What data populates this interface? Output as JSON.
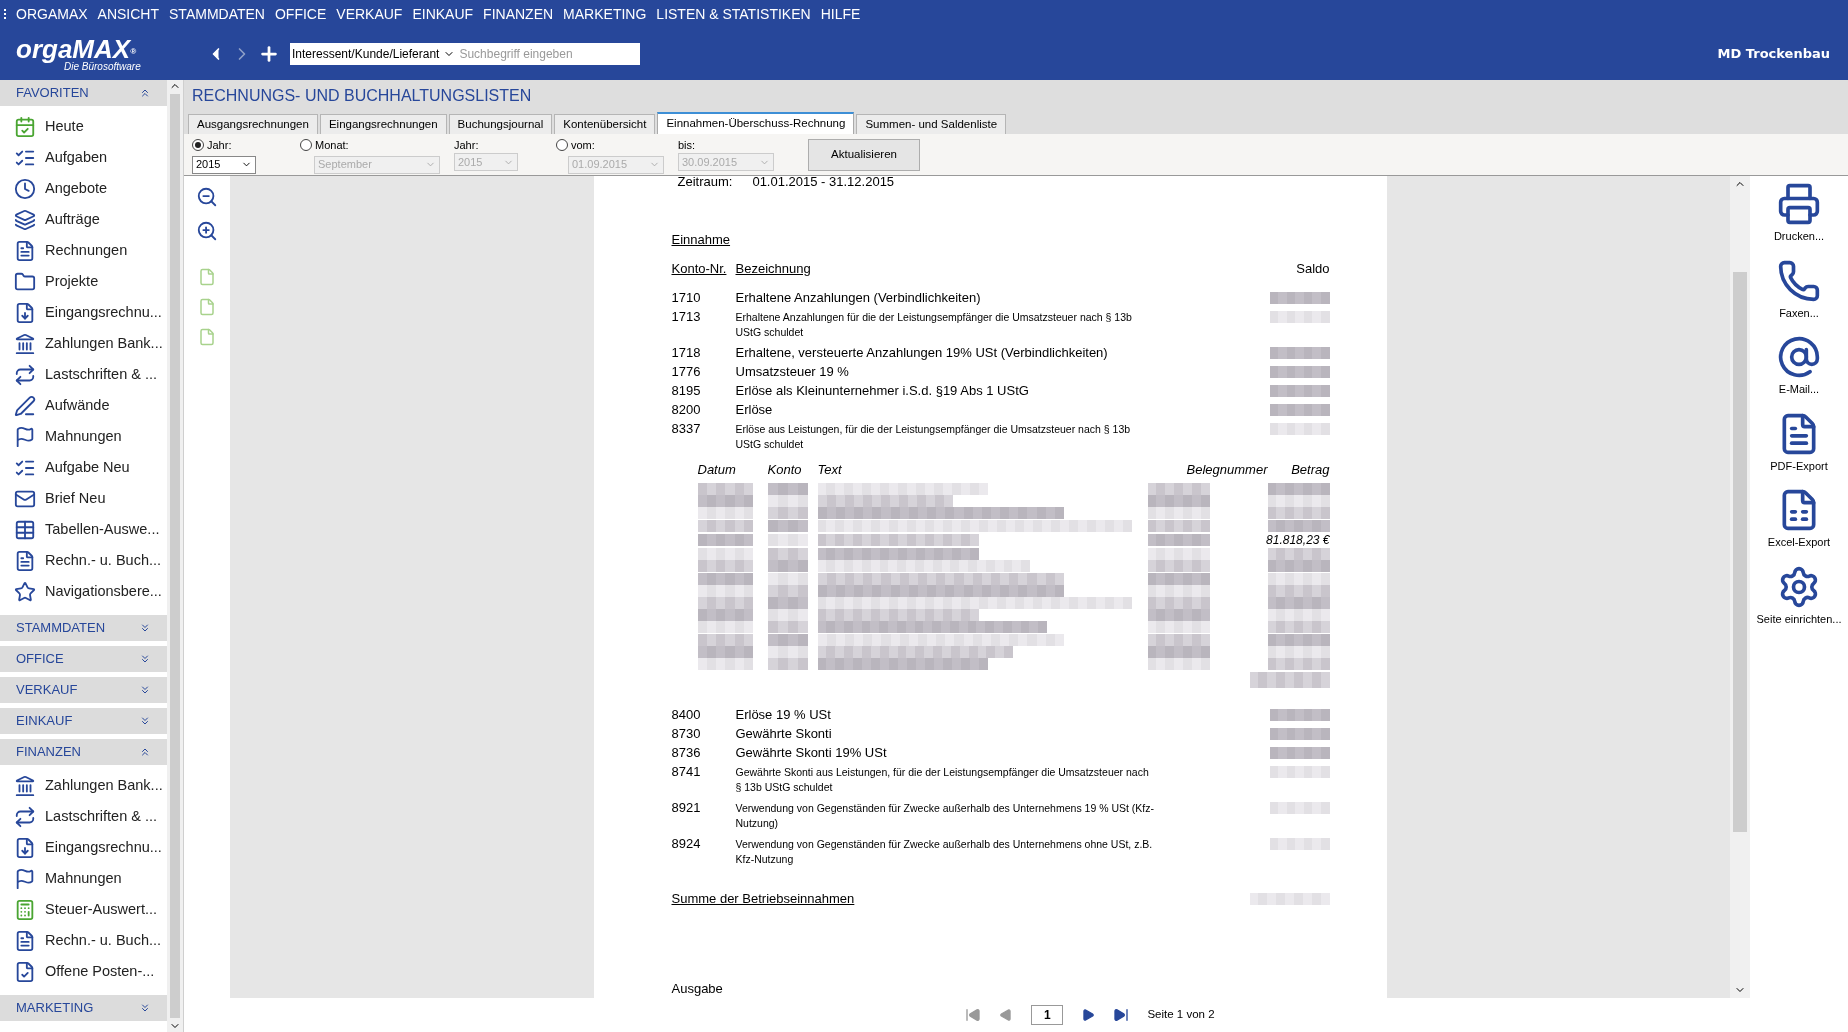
{
  "menu_bar": [
    "ORGAMAX",
    "ANSICHT",
    "STAMMDATEN",
    "OFFICE",
    "VERKAUF",
    "EINKAUF",
    "FINANZEN",
    "MARKETING",
    "LISTEN & STATISTIKEN",
    "HILFE"
  ],
  "header": {
    "logo": "orgaMAX",
    "logo_mark": "®",
    "logo_tagline": "Die Bürosoftware",
    "search_category": "Interessent/Kunde/Lieferant",
    "search": {
      "placeholder": "Suchbegriff eingeben"
    },
    "company": "MD Trockenbau"
  },
  "sidebar": [
    {
      "label": "FAVORITEN",
      "expanded": true,
      "items": [
        "Heute",
        "Aufgaben",
        "Angebote",
        "Aufträge",
        "Rechnungen",
        "Projekte",
        "Eingangsrechnu...",
        "Zahlungen Bank...",
        "Lastschriften & ...",
        "Aufwände",
        "Mahnungen",
        "Aufgabe Neu",
        "Brief Neu",
        "Tabellen-Auswe...",
        "Rechn.- u. Buch...",
        "Navigationsbere..."
      ]
    },
    {
      "label": "STAMMDATEN",
      "expanded": false
    },
    {
      "label": "OFFICE",
      "expanded": false
    },
    {
      "label": "VERKAUF",
      "expanded": false
    },
    {
      "label": "EINKAUF",
      "expanded": false
    },
    {
      "label": "FINANZEN",
      "expanded": true,
      "items": [
        "Zahlungen Bank...",
        "Lastschriften & ...",
        "Eingangsrechnu...",
        "Mahnungen",
        "Steuer-Auswert...",
        "Rechn.- u. Buch...",
        "Offene Posten-..."
      ]
    },
    {
      "label": "MARKETING",
      "expanded": false
    }
  ],
  "page_title": "RECHNUNGS- UND BUCHHALTUNGSLISTEN",
  "tabs": [
    {
      "label": "Ausgangsrechnungen",
      "selected": false
    },
    {
      "label": "Eingangsrechnungen",
      "selected": false
    },
    {
      "label": "Buchungsjournal",
      "selected": false
    },
    {
      "label": "Kontenübersicht",
      "selected": false
    },
    {
      "label": "Einnahmen-Überschuss-Rechnung",
      "selected": true
    },
    {
      "label": "Summen- und Saldenliste",
      "selected": false
    }
  ],
  "filters": {
    "year": {
      "label": "Jahr:",
      "selected": true,
      "value": "2015",
      "disabled": false
    },
    "month": {
      "label": "Monat:",
      "selected": false,
      "value": "September",
      "disabled": true,
      "year_label": "Jahr:",
      "year_value": "2015"
    },
    "range": {
      "label": "vom:",
      "selected": false,
      "from": "01.09.2015",
      "to_label": "bis:",
      "to": "30.09.2015",
      "disabled": true
    },
    "button": "Aktualisieren"
  },
  "report": {
    "period_label": "Zeitraum:",
    "period": "01.01.2015 - 31.12.2015",
    "section": "Einnahme",
    "columns": [
      "Konto-Nr.",
      "Bezeichnung",
      "Saldo"
    ],
    "accounts_before": [
      {
        "number": "1710",
        "name": "Erhaltene Anzahlungen (Verbindlichkeiten)",
        "kind": "main"
      },
      {
        "number": "1713",
        "name": "Erhaltene Anzahlungen für die der Leistungsempfänger die Umsatzsteuer nach § 13b UStG schuldet",
        "kind": "note"
      },
      {
        "number": "1718",
        "name": "Erhaltene, versteuerte Anzahlungen 19% USt (Verbindlichkeiten)",
        "kind": "main"
      },
      {
        "number": "1776",
        "name": "Umsatzsteuer 19 %",
        "kind": "main"
      },
      {
        "number": "8195",
        "name": "Erlöse als Kleinunternehmer i.S.d. §19 Abs 1 UStG",
        "kind": "main"
      },
      {
        "number": "8200",
        "name": "Erlöse",
        "kind": "main"
      },
      {
        "number": "8337",
        "name": "Erlöse aus Leistungen, für die der Leistungsempfänger die Umsatzsteuer nach § 13b UStG schuldet",
        "kind": "note"
      }
    ],
    "detail_columns": [
      "Datum",
      "Konto",
      "Text",
      "Belegnummer",
      "Betrag"
    ],
    "detail_rows": [
      {
        "kind": "blurred"
      },
      {
        "kind": "blurred"
      },
      {
        "kind": "blurred"
      },
      {
        "kind": "blurred"
      },
      {
        "kind": "blurred",
        "betrag": "81.818,23 €"
      },
      {
        "kind": "blurred"
      },
      {
        "kind": "blurred"
      },
      {
        "kind": "blurred"
      },
      {
        "kind": "blurred"
      },
      {
        "kind": "blurred"
      },
      {
        "kind": "blurred"
      },
      {
        "kind": "blurred"
      },
      {
        "kind": "blurred"
      },
      {
        "kind": "blurred"
      },
      {
        "kind": "blurred"
      }
    ],
    "accounts_after": [
      {
        "number": "8400",
        "name": "Erlöse 19 % USt",
        "kind": "main"
      },
      {
        "number": "8730",
        "name": "Gewährte Skonti",
        "kind": "main"
      },
      {
        "number": "8736",
        "name": "Gewährte Skonti 19% USt",
        "kind": "main"
      },
      {
        "number": "8741",
        "name": "Gewährte Skonti aus Leistungen, für die der Leistungsempfänger die Umsatzsteuer nach § 13b UStG schuldet",
        "kind": "note"
      },
      {
        "number": "8921",
        "name": "Verwendung von Gegenständen für Zwecke außerhalb des Unternehmens 19 % USt (Kfz-Nutzung)",
        "kind": "note"
      },
      {
        "number": "8924",
        "name": "Verwendung von Gegenständen für Zwecke außerhalb des Unternehmens ohne USt, z.B. Kfz-Nutzung",
        "kind": "note"
      }
    ],
    "total_label": "Summe der Betriebseinnahmen",
    "next_section": "Ausgabe"
  },
  "pager": {
    "page": "1",
    "info": "Seite 1 von 2"
  },
  "actions": [
    "Drucken...",
    "Faxen...",
    "E-Mail...",
    "PDF-Export",
    "Excel-Export",
    "Seite einrichten..."
  ]
}
